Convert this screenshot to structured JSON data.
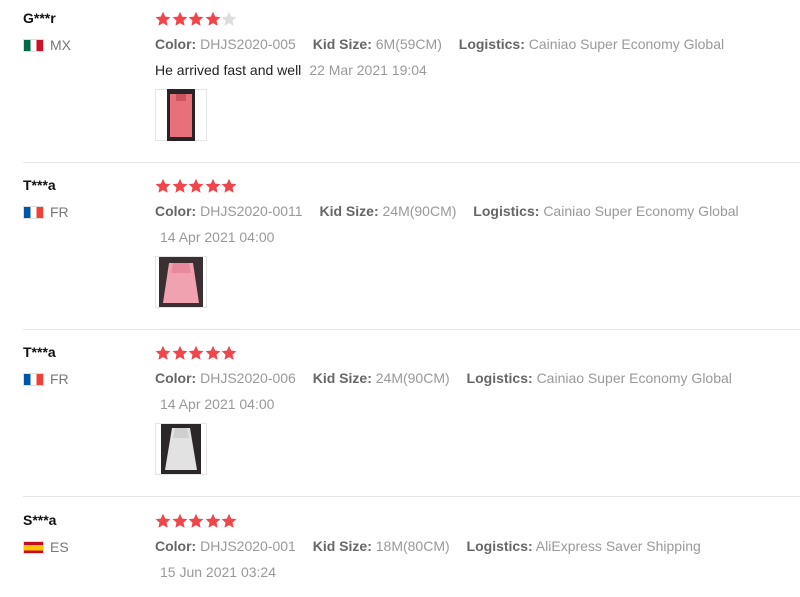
{
  "reviews": [
    {
      "user": "G***r",
      "country": "MX",
      "rating": 4,
      "color_label": "Color:",
      "color": "DHJS2020-005",
      "size_label": "Kid Size:",
      "size": "6M(59CM)",
      "logistics_label": "Logistics:",
      "logistics": "Cainiao Super Economy Global",
      "text": "He arrived fast and well",
      "date": "22 Mar 2021 19:04"
    },
    {
      "user": "T***a",
      "country": "FR",
      "rating": 5,
      "color_label": "Color:",
      "color": "DHJS2020-0011",
      "size_label": "Kid Size:",
      "size": "24M(90CM)",
      "logistics_label": "Logistics:",
      "logistics": "Cainiao Super Economy Global",
      "text": "",
      "date": "14 Apr 2021 04:00"
    },
    {
      "user": "T***a",
      "country": "FR",
      "rating": 5,
      "color_label": "Color:",
      "color": "DHJS2020-006",
      "size_label": "Kid Size:",
      "size": "24M(90CM)",
      "logistics_label": "Logistics:",
      "logistics": "Cainiao Super Economy Global",
      "text": "",
      "date": "14 Apr 2021 04:00"
    },
    {
      "user": "S***a",
      "country": "ES",
      "rating": 5,
      "color_label": "Color:",
      "color": "DHJS2020-001",
      "size_label": "Kid Size:",
      "size": "18M(80CM)",
      "logistics_label": "Logistics:",
      "logistics": "AliExpress Saver Shipping",
      "text": "",
      "date": "15 Jun 2021 03:24"
    }
  ],
  "colors": {
    "star_filled": "#f0464b",
    "star_empty": "#dddddd"
  }
}
